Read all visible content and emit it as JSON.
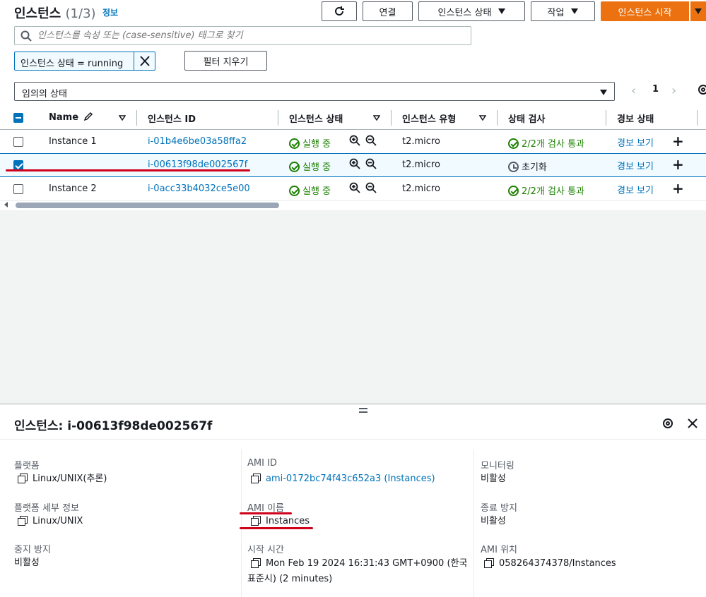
{
  "header": {
    "title": "인스턴스",
    "count": "(1/3)",
    "info_link": "정보",
    "connect_label": "연결",
    "instance_state_label": "인스턴스 상태",
    "actions_label": "작업",
    "launch_label": "인스턴스 시작"
  },
  "search": {
    "placeholder": "인스턴스를 속성 또는 (case-sensitive) 태그로 찾기"
  },
  "filter": {
    "token": "인스턴스 상태 = running",
    "clear_label": "필터 지우기"
  },
  "state_select": {
    "value": "임의의 상태"
  },
  "pagination": {
    "page": "1"
  },
  "table": {
    "columns": [
      "Name",
      "인스턴스 ID",
      "인스턴스 상태",
      "인스턴스 유형",
      "상태 검사",
      "경보 상태"
    ],
    "rows": [
      {
        "name": "Instance 1",
        "id": "i-01b4e6be03a58ffa2",
        "state": "실행 중",
        "type": "t2.micro",
        "check": "2/2개 검사 통과",
        "alarm": "경보 보기",
        "selected": false
      },
      {
        "name": "",
        "id": "i-00613f98de002567f",
        "state": "실행 중",
        "type": "t2.micro",
        "check": "초기화",
        "alarm": "경보 보기",
        "selected": true
      },
      {
        "name": "Instance 2",
        "id": "i-0acc33b4032ce5e00",
        "state": "실행 중",
        "type": "t2.micro",
        "check": "2/2개 검사 통과",
        "alarm": "경보 보기",
        "selected": false
      }
    ]
  },
  "detail": {
    "title": "인스턴스: i-00613f98de002567f",
    "fields": {
      "platform_label": "플랫폼",
      "platform_value": "Linux/UNIX(추론)",
      "platform_detail_label": "플랫폼 세부 정보",
      "platform_detail_value": "Linux/UNIX",
      "stop_protection_label": "중지 방지",
      "stop_protection_value": "비활성",
      "ami_id_label": "AMI ID",
      "ami_id_value": "ami-0172bc74f43c652a3 (Instances)",
      "ami_name_label": "AMI 이름",
      "ami_name_value": "Instances",
      "launch_time_label": "시작 시간",
      "launch_time_value_1": "Mon Feb 19 2024 16:31:43 GMT+0900 (한국",
      "launch_time_value_2": "표준시) (2 minutes)",
      "monitoring_label": "모니터링",
      "monitoring_value": "비활성",
      "termination_label": "종료 방지",
      "termination_value": "비활성",
      "ami_location_label": "AMI 위치",
      "ami_location_value": "058264374378/Instances"
    }
  },
  "colors": {
    "accent": "#0073bb",
    "success": "#1d8102",
    "primary_button": "#ec7211",
    "annotation": "#d0021b"
  }
}
